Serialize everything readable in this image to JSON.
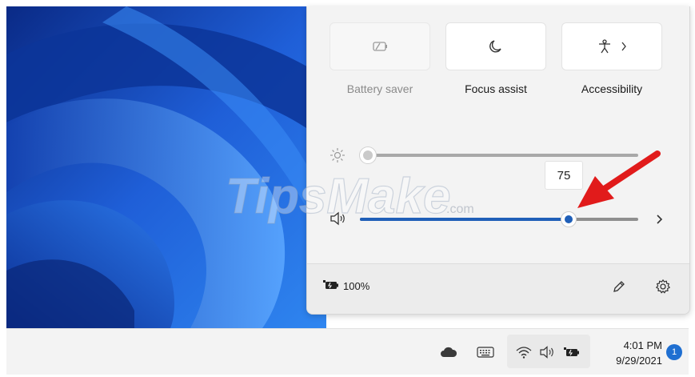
{
  "quick_settings": {
    "tiles": [
      {
        "label": "Battery saver",
        "icon": "battery-saver-icon",
        "enabled": false
      },
      {
        "label": "Focus assist",
        "icon": "moon-icon",
        "enabled": true
      },
      {
        "label": "Accessibility",
        "icon": "accessibility-icon",
        "enabled": true,
        "has_submenu": true
      }
    ],
    "brightness": {
      "icon": "sun-icon",
      "level_percent": 0
    },
    "volume": {
      "icon": "speaker-icon",
      "level_percent": 75,
      "tooltip": "75"
    },
    "footer": {
      "battery_icon": "battery-icon",
      "battery_text": "100%",
      "edit_icon": "pencil-icon",
      "settings_icon": "gear-icon"
    }
  },
  "watermark": {
    "brand_main": "TipsMake",
    "brand_suffix": ".com"
  },
  "taskbar": {
    "tray_icons": [
      "onedrive-cloud-icon",
      "touch-keyboard-icon",
      "wifi-icon",
      "speaker-icon",
      "battery-icon"
    ],
    "time": "4:01 PM",
    "date": "9/29/2021",
    "notification_count": "1"
  },
  "colors": {
    "accent": "#1f5fb8",
    "arrow": "#e11b1b",
    "badge": "#1f6fd1"
  }
}
